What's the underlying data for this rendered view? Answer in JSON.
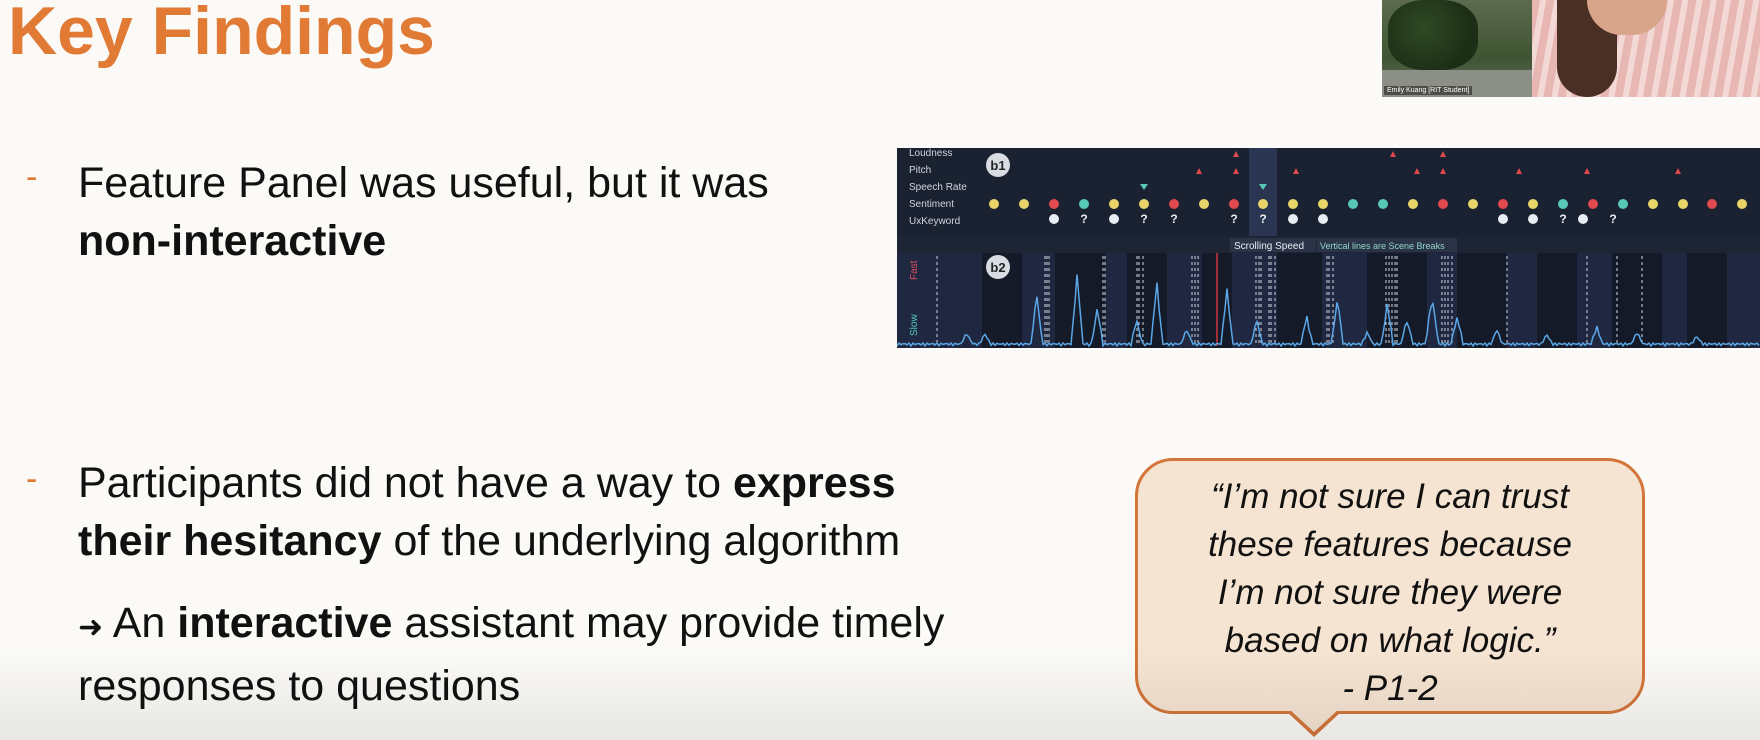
{
  "slide": {
    "title": "Key Findings",
    "bullets": [
      {
        "dash": "-",
        "line1": "Feature Panel was useful, but it was",
        "line2_bold": "non-interactive"
      },
      {
        "dash": "-",
        "line1_plain": "Participants did not have a way to ",
        "line1_bold": "express",
        "line2_bold": "their hesitancy",
        "line2_plain": " of the underlying algorithm"
      }
    ],
    "sub_bullet": {
      "arrow": "➜",
      "plain1": "An ",
      "bold": "interactive",
      "plain2": " assistant may provide timely",
      "line2": "responses to questions"
    },
    "quote": {
      "line1": "“I’m not sure I can trust",
      "line2": "these features because",
      "line3": "I’m not sure they were",
      "line4": "based on what logic.”",
      "attribution": "- P1-2"
    }
  },
  "video_overlay": {
    "name_label": "Emily Kuang [RIT Student]"
  },
  "feature_panel": {
    "row_labels": [
      "Loudness",
      "Pitch",
      "Speech Rate",
      "Sentiment",
      "UxKeyword"
    ],
    "badges": [
      "b1",
      "b2"
    ],
    "scroll_label": "Scrolling Speed",
    "scene_note": "Vertical lines are Scene Breaks",
    "axis_fast": "Fast",
    "axis_slow": "Slow",
    "keyword_marks": [
      "?",
      "?",
      "?",
      "?",
      "?",
      "?",
      "?"
    ]
  },
  "colors": {
    "accent": "#e07a35",
    "panel_bg": "#1d2434",
    "graph_line": "#5aa6e6"
  }
}
